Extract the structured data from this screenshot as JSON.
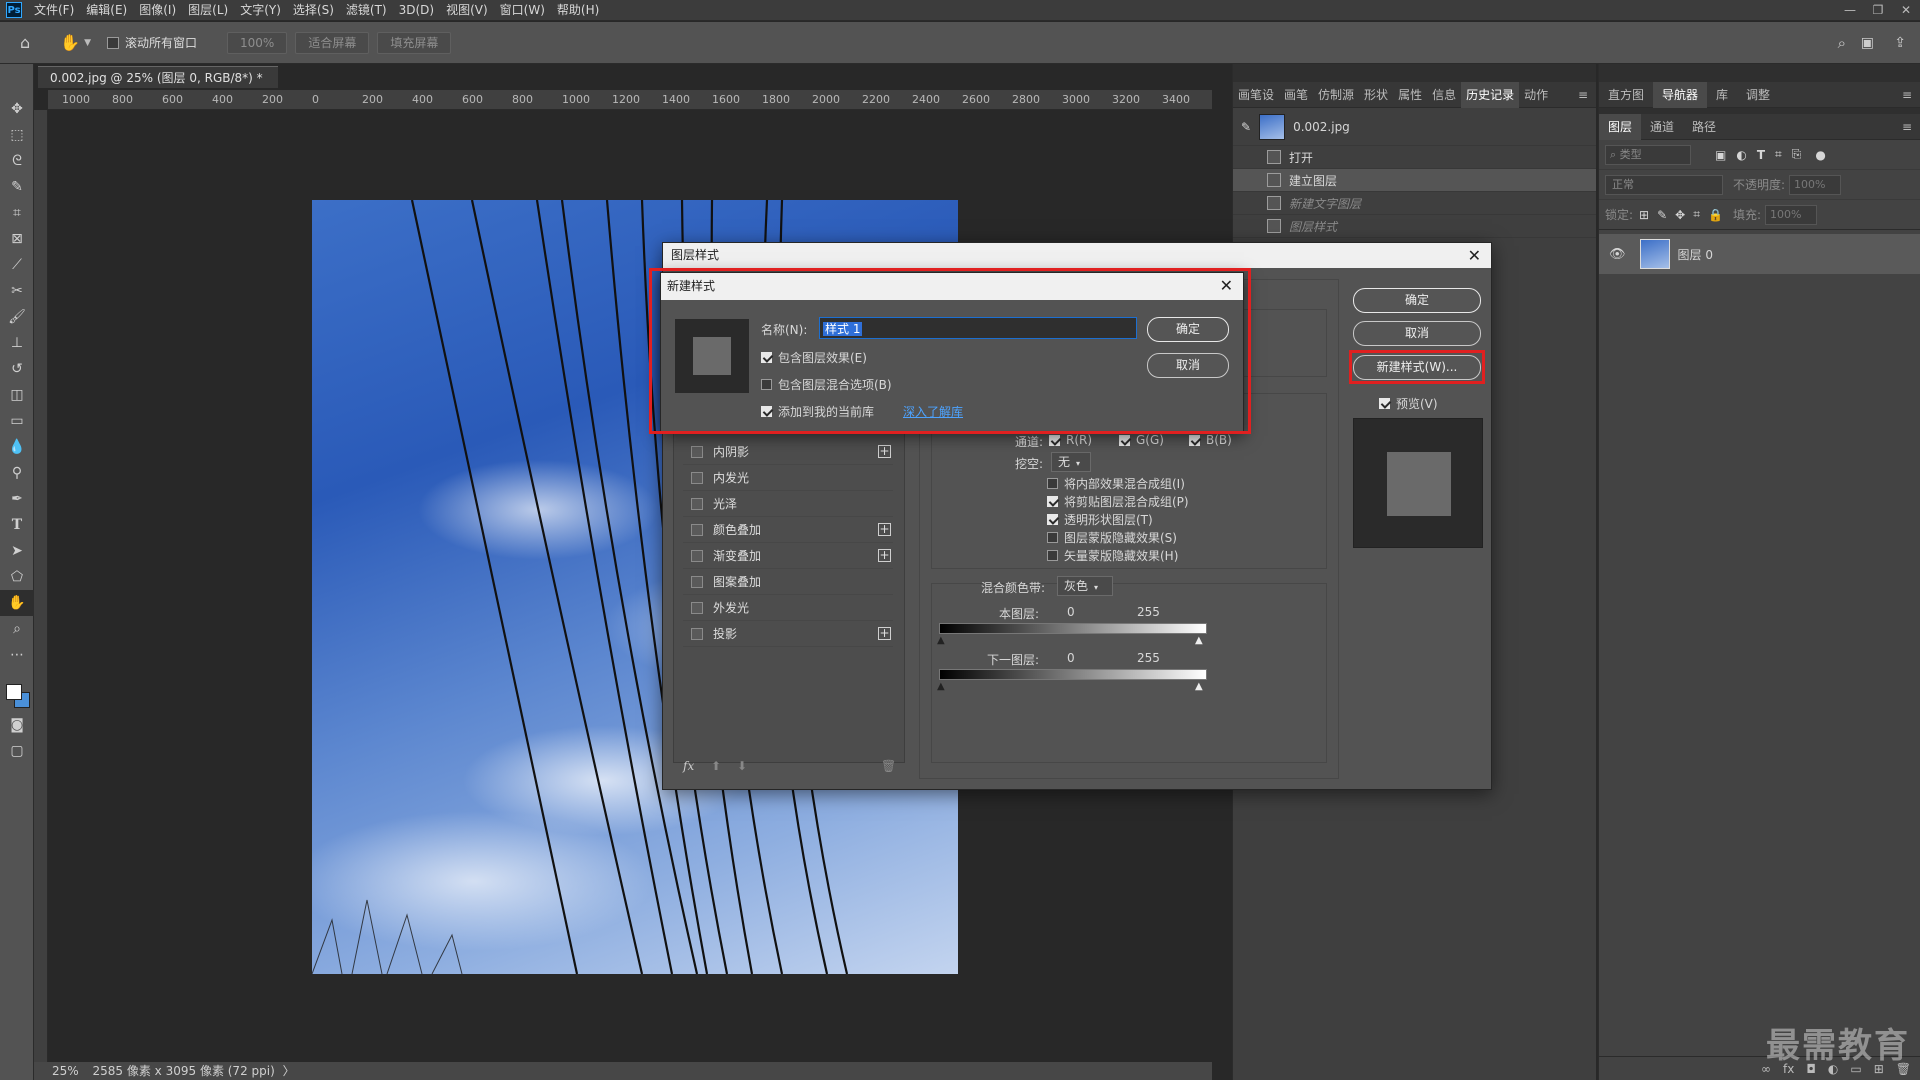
{
  "app": {
    "logo": "Ps",
    "menu": [
      "文件(F)",
      "编辑(E)",
      "图像(I)",
      "图层(L)",
      "文字(Y)",
      "选择(S)",
      "滤镜(T)",
      "3D(D)",
      "视图(V)",
      "窗口(W)",
      "帮助(H)"
    ]
  },
  "options": {
    "scroll_all_label": "滚动所有窗口",
    "zoom_100": "100%",
    "fit_screen": "适合屏幕",
    "fill_screen": "填充屏幕"
  },
  "document": {
    "tab_title": "0.002.jpg @ 25% (图层 0, RGB/8*) *",
    "ruler_ticks": [
      "1000",
      "800",
      "600",
      "400",
      "200",
      "0",
      "200",
      "400",
      "600",
      "800",
      "1000",
      "1200",
      "1400",
      "1600",
      "1800",
      "2000",
      "2200",
      "2400",
      "2600",
      "2800",
      "3000",
      "3200",
      "3400"
    ],
    "zoom": "25%",
    "status_info": "2585 像素 x 3095 像素 (72 ppi)"
  },
  "panelA": {
    "tabs": [
      "画笔设",
      "画笔",
      "仿制源",
      "形状",
      "属性",
      "信息",
      "历史记录",
      "动作"
    ],
    "active_tab": "历史记录",
    "snapshot": "0.002.jpg",
    "history": [
      {
        "label": "打开",
        "state": "normal"
      },
      {
        "label": "建立图层",
        "state": "selected"
      },
      {
        "label": "新建文字图层",
        "state": "dim"
      },
      {
        "label": "图层样式",
        "state": "dim"
      }
    ]
  },
  "panelB": {
    "top_tabs": [
      "直方图",
      "导航器",
      "库",
      "调整"
    ],
    "active_top": "导航器",
    "tabs": [
      "图层",
      "通道",
      "路径"
    ],
    "active_tab": "图层",
    "filter_type": "类型",
    "blend_mode": "正常",
    "opacity_label": "不透明度:",
    "opacity_value": "100%",
    "lock_label": "锁定:",
    "fill_label": "填充:",
    "fill_value": "100%",
    "layer_name": "图层 0"
  },
  "layer_style": {
    "title": "图层样式",
    "ok": "确定",
    "cancel": "取消",
    "new_style": "新建样式(W)...",
    "preview": "预览(V)",
    "styles": [
      {
        "label": "内阴影",
        "plus": true
      },
      {
        "label": "内发光",
        "plus": false
      },
      {
        "label": "光泽",
        "plus": false
      },
      {
        "label": "颜色叠加",
        "plus": true
      },
      {
        "label": "渐变叠加",
        "plus": true
      },
      {
        "label": "图案叠加",
        "plus": false
      },
      {
        "label": "外发光",
        "plus": false
      },
      {
        "label": "投影",
        "plus": true
      }
    ],
    "channels_label": "通道:",
    "channel_r": "R(R)",
    "channel_g": "G(G)",
    "channel_b": "B(B)",
    "knockout_label": "挖空:",
    "knockout_value": "无",
    "adv_options": [
      {
        "label": "将内部效果混合成组(I)",
        "checked": false
      },
      {
        "label": "将剪贴图层混合成组(P)",
        "checked": true
      },
      {
        "label": "透明形状图层(T)",
        "checked": true
      },
      {
        "label": "图层蒙版隐藏效果(S)",
        "checked": false
      },
      {
        "label": "矢量蒙版隐藏效果(H)",
        "checked": false
      }
    ],
    "blend_if_label": "混合颜色带:",
    "blend_if_value": "灰色",
    "this_layer": "本图层:",
    "underlying": "下一图层:",
    "min_val": "0",
    "max_val": "255",
    "fx": "fx"
  },
  "new_style": {
    "title": "新建样式",
    "name_label": "名称(N):",
    "name_value": "样式 1",
    "ok": "确定",
    "cancel": "取消",
    "include_effects": "包含图层效果(E)",
    "include_blending": "包含图层混合选项(B)",
    "add_library": "添加到我的当前库",
    "learn_more": "深入了解库"
  },
  "watermark": "最需教育"
}
